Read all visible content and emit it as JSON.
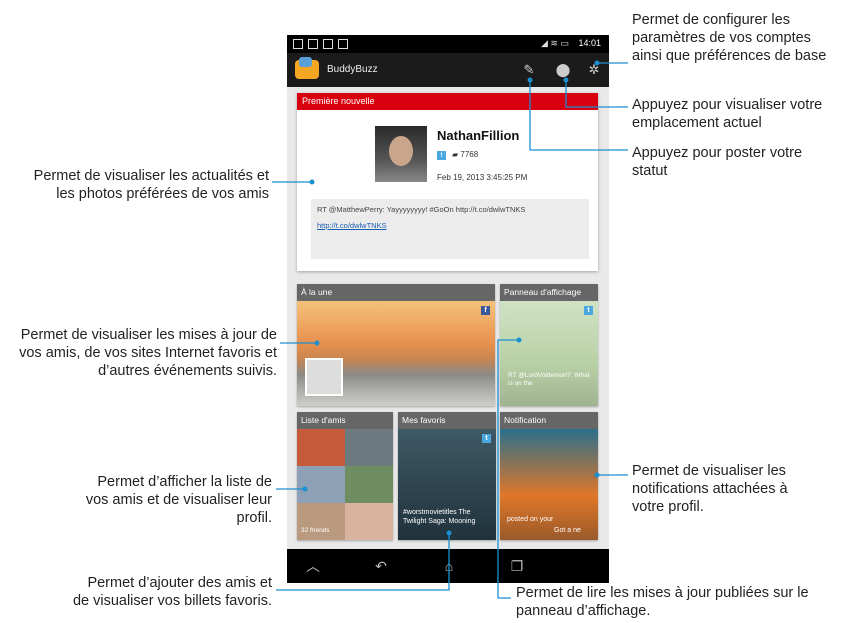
{
  "statusbar": {
    "time": "14:01"
  },
  "app": {
    "title": "BuddyBuzz"
  },
  "news_card": {
    "header": "Première nouvelle",
    "name": "NathanFillion",
    "twitter_badge": "t",
    "followers": "7768",
    "date": "Feb 19, 2013 3:45:25 PM",
    "body": "RT @MatthewPerry: Yayyyyyyyy! #GoOn http://t.co/dwlwTNKS",
    "link": "http://t.co/dwlwTNKS"
  },
  "tiles": {
    "headline": {
      "title": "À la une",
      "badge": "f"
    },
    "board": {
      "title": "Panneau d'affichage",
      "badge": "t",
      "caption": "RT @LordVoldemort7: What is on the"
    },
    "friends": {
      "title": "Liste d'amis",
      "caption": "32 friends"
    },
    "favorites": {
      "title": "Mes favoris",
      "badge": "t",
      "caption": "#worstmovietitles The Twilight Saga: Mooning"
    },
    "notification": {
      "title": "Notification",
      "caption": "posted on your",
      "caption2": "Got a ne"
    }
  },
  "callouts": {
    "settings": "Permet de configurer les paramètres de vos comptes ainsi que préférences de base",
    "location": "Appuyez pour visualiser votre emplacement actuel",
    "status": "Appuyez pour poster votre statut",
    "news": "Permet de visualiser les actualités et les photos préférées de vos amis",
    "headline": "Permet de visualiser les mises à jour de vos amis, de vos sites Internet favoris et d’autres événements suivis.",
    "notification": "Permet de visualiser les notifications attachées à votre profil.",
    "friends": "Permet d’afficher la liste de vos amis et de visualiser leur profil.",
    "favorites": "Permet d’ajouter des amis et de visualiser vos billets favoris.",
    "board": "Permet de lire les mises à jour publiées sur le panneau d’affichage."
  },
  "icons": {
    "compose": "compose-icon",
    "location": "location-pin-icon",
    "settings": "gear-icon",
    "back": "back-icon",
    "home": "home-icon",
    "recents": "recent-apps-icon",
    "menu": "menu-icon"
  },
  "colors": {
    "news_header": "#d8000f",
    "callout_line": "#1a8fd1",
    "twitter": "#4aa8e0",
    "facebook": "#3b5998"
  }
}
